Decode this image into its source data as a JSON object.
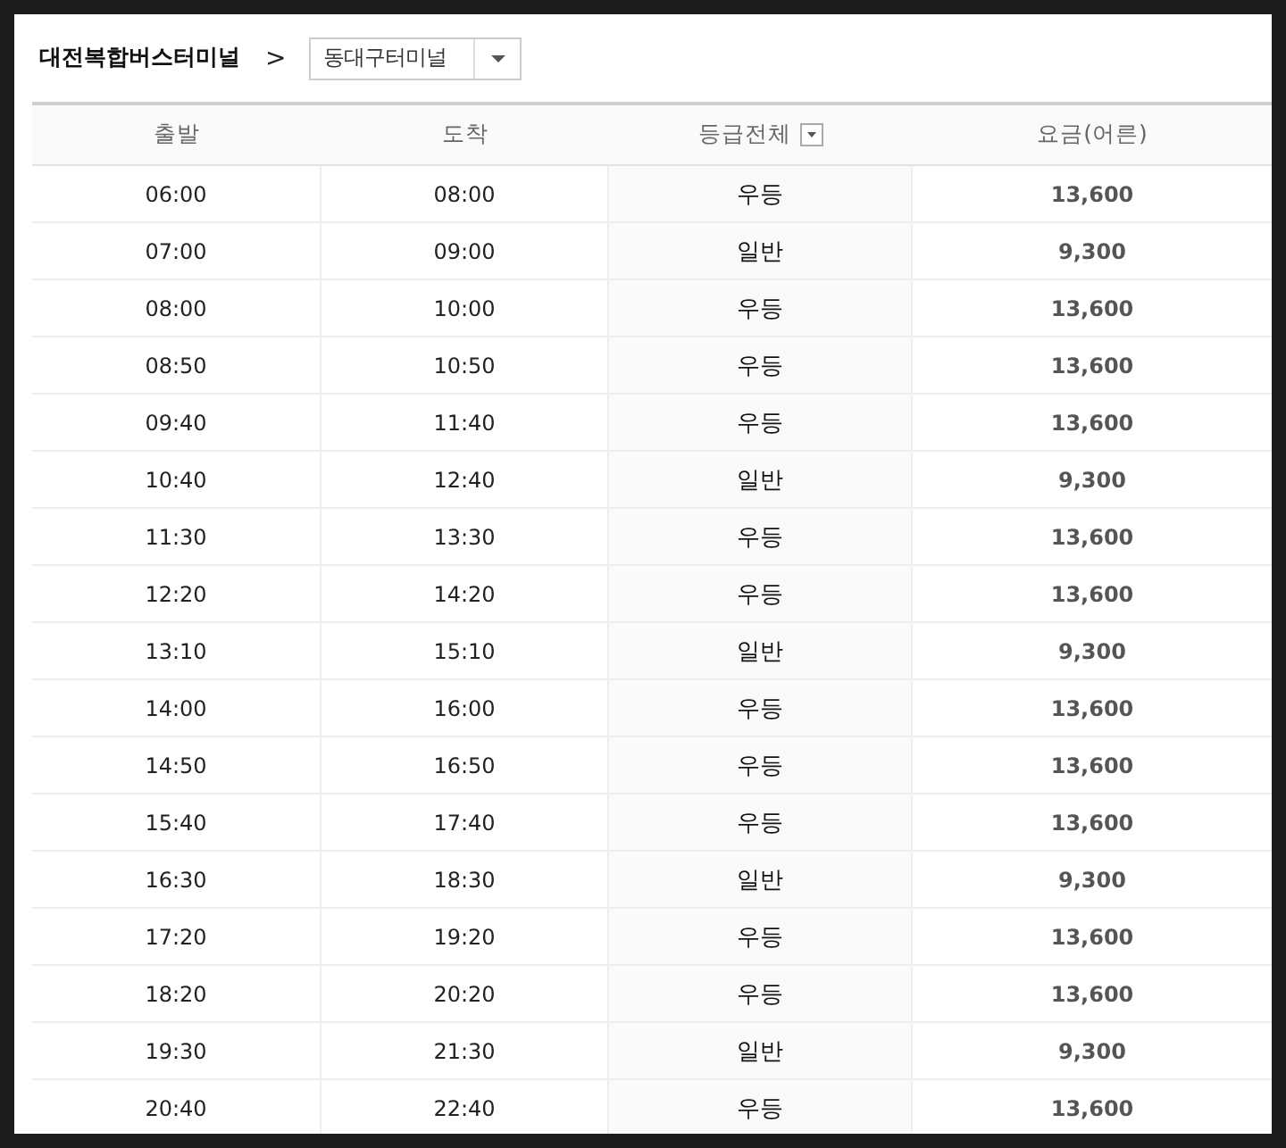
{
  "breadcrumb": {
    "origin": "대전복합버스터미널",
    "separator": ">",
    "destination_select": {
      "value": "동대구터미널"
    }
  },
  "table": {
    "columns": [
      {
        "label": "출발",
        "kind": "plain"
      },
      {
        "label": "도착",
        "kind": "plain"
      },
      {
        "label": "등급전체",
        "kind": "filter"
      },
      {
        "label": "요금(어른)",
        "kind": "plain"
      }
    ],
    "rows": [
      {
        "departure": "06:00",
        "arrival": "08:00",
        "grade": "우등",
        "fare": "13,600"
      },
      {
        "departure": "07:00",
        "arrival": "09:00",
        "grade": "일반",
        "fare": "9,300"
      },
      {
        "departure": "08:00",
        "arrival": "10:00",
        "grade": "우등",
        "fare": "13,600"
      },
      {
        "departure": "08:50",
        "arrival": "10:50",
        "grade": "우등",
        "fare": "13,600"
      },
      {
        "departure": "09:40",
        "arrival": "11:40",
        "grade": "우등",
        "fare": "13,600"
      },
      {
        "departure": "10:40",
        "arrival": "12:40",
        "grade": "일반",
        "fare": "9,300"
      },
      {
        "departure": "11:30",
        "arrival": "13:30",
        "grade": "우등",
        "fare": "13,600"
      },
      {
        "departure": "12:20",
        "arrival": "14:20",
        "grade": "우등",
        "fare": "13,600"
      },
      {
        "departure": "13:10",
        "arrival": "15:10",
        "grade": "일반",
        "fare": "9,300"
      },
      {
        "departure": "14:00",
        "arrival": "16:00",
        "grade": "우등",
        "fare": "13,600"
      },
      {
        "departure": "14:50",
        "arrival": "16:50",
        "grade": "우등",
        "fare": "13,600"
      },
      {
        "departure": "15:40",
        "arrival": "17:40",
        "grade": "우등",
        "fare": "13,600"
      },
      {
        "departure": "16:30",
        "arrival": "18:30",
        "grade": "일반",
        "fare": "9,300"
      },
      {
        "departure": "17:20",
        "arrival": "19:20",
        "grade": "우등",
        "fare": "13,600"
      },
      {
        "departure": "18:20",
        "arrival": "20:20",
        "grade": "우등",
        "fare": "13,600"
      },
      {
        "departure": "19:30",
        "arrival": "21:30",
        "grade": "일반",
        "fare": "9,300"
      },
      {
        "departure": "20:40",
        "arrival": "22:40",
        "grade": "우등",
        "fare": "13,600"
      }
    ]
  }
}
